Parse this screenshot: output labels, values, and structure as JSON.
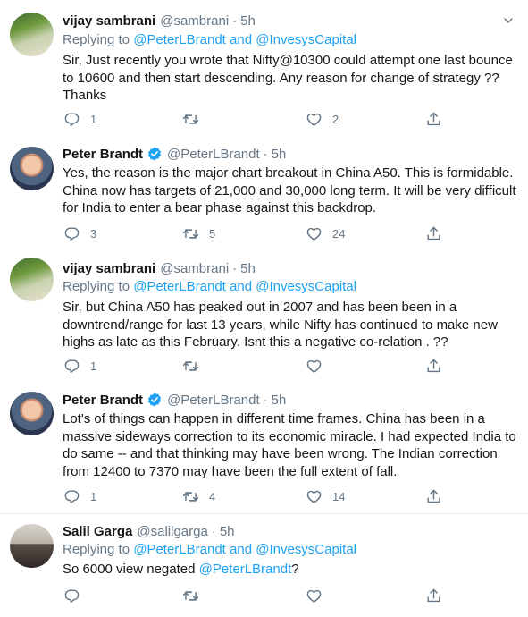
{
  "tweets": [
    {
      "name": "vijay sambrani",
      "handle": "@sambrani",
      "time": "5h",
      "verified": false,
      "reply_prefix": "Replying to ",
      "reply_user1": "@PeterLBrandt",
      "reply_and": " and ",
      "reply_user2": "@InvesysCapital",
      "text": "Sir, Just recently you wrote that Nifty@10300 could attempt one last bounce to 10600 and then start descending. Any reason for change of strategy ?? Thanks",
      "replies": "1",
      "retweets": "",
      "likes": "2"
    },
    {
      "name": "Peter Brandt",
      "handle": "@PeterLBrandt",
      "time": "5h",
      "verified": true,
      "text": "Yes, the reason is the major chart breakout in China A50. This is formidable. China now has targets of 21,000 and 30,000 long term. It will be very difficult for India to enter a bear phase against this backdrop.",
      "replies": "3",
      "retweets": "5",
      "likes": "24"
    },
    {
      "name": "vijay sambrani",
      "handle": "@sambrani",
      "time": "5h",
      "verified": false,
      "reply_prefix": "Replying to ",
      "reply_user1": "@PeterLBrandt",
      "reply_and": " and ",
      "reply_user2": "@InvesysCapital",
      "text": "Sir, but China A50 has peaked out in 2007 and has been been in a downtrend/range for last 13 years, while Nifty has continued to make new highs as late as this February. Isnt this a negative co-relation . ??",
      "replies": "1",
      "retweets": "",
      "likes": ""
    },
    {
      "name": "Peter Brandt",
      "handle": "@PeterLBrandt",
      "time": "5h",
      "verified": true,
      "text": "Lot's of things can happen in different time frames. China has been in a massive sideways correction to its economic miracle. I had expected India to do same -- and that thinking may have been wrong. The Indian correction from 12400 to 7370 may have been the full extent of fall.",
      "replies": "1",
      "retweets": "4",
      "likes": "14"
    },
    {
      "name": "Salil Garga",
      "handle": "@salilgarga",
      "time": "5h",
      "verified": false,
      "reply_prefix": "Replying to ",
      "reply_user1": "@PeterLBrandt",
      "reply_and": " and ",
      "reply_user2": "@InvesysCapital",
      "text_prefix": "So 6000 view negated ",
      "text_mention": "@PeterLBrandt",
      "text_suffix": "?",
      "replies": "",
      "retweets": "",
      "likes": ""
    }
  ],
  "separator_dot": "·",
  "icons": {
    "reply": "reply-icon",
    "retweet": "retweet-icon",
    "like": "heart-icon",
    "share": "share-icon",
    "more": "chevron-down-icon",
    "verified": "verified-badge-icon"
  },
  "colors": {
    "text": "#14171a",
    "muted": "#657786",
    "link": "#1da1f2",
    "verified": "#1da1f2",
    "divider": "#e6ecf0"
  }
}
